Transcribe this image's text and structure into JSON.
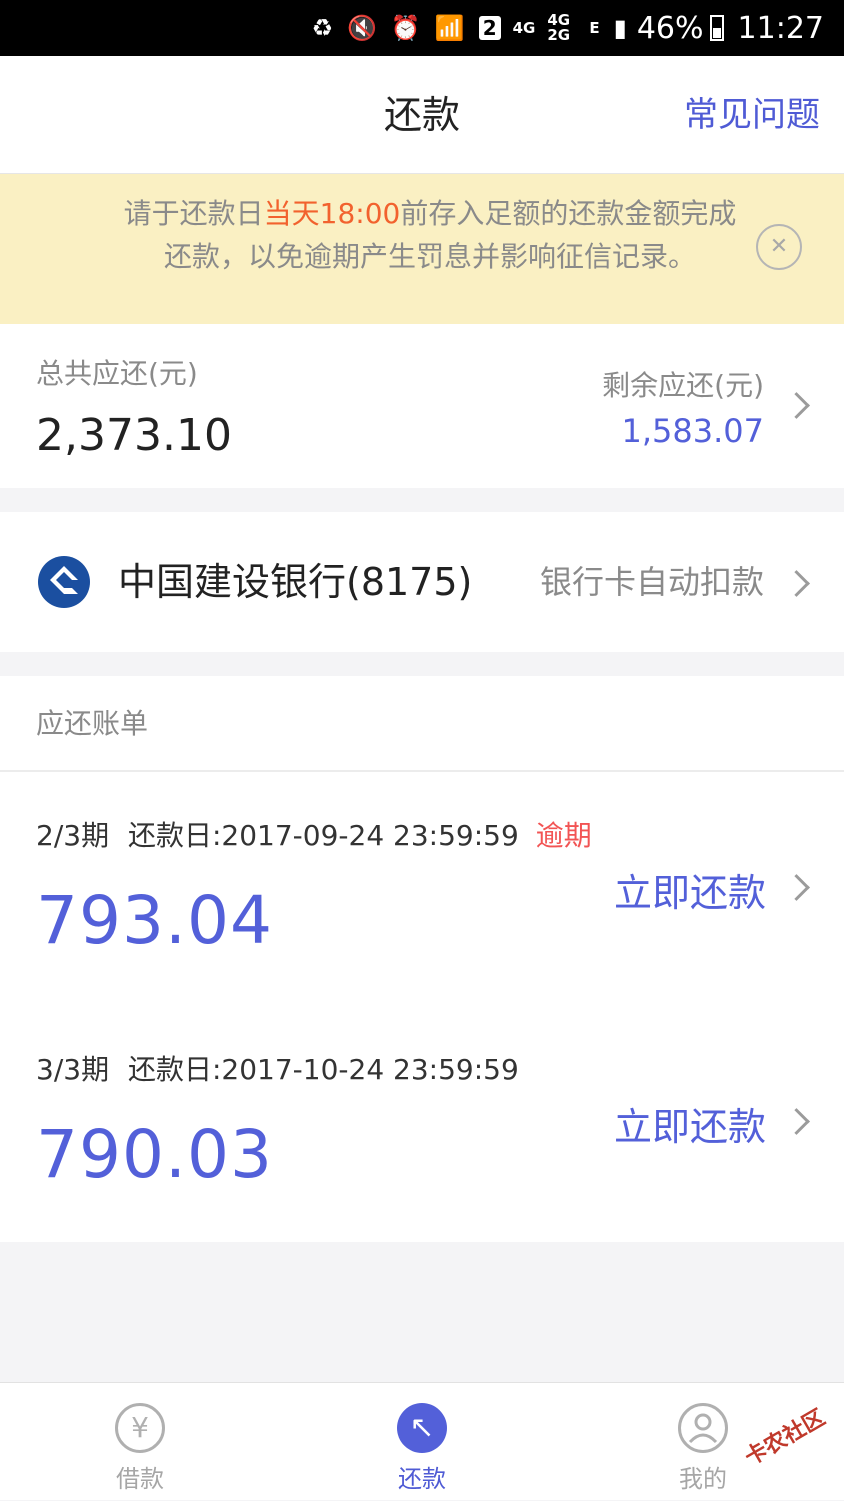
{
  "status_bar": {
    "sim": "2",
    "network_4g": "4G",
    "network_4g2g": "4G 2G",
    "network_e": "E",
    "battery": "46%",
    "time": "11:27"
  },
  "header": {
    "title": "还款",
    "faq_label": "常见问题"
  },
  "notice": {
    "text_before": "请于还款日",
    "text_highlight": "当天18:00",
    "text_after": "前存入足额的还款金额完成还款，以免逾期产生罚息并影响征信记录。",
    "highlight_color": "#f2622e"
  },
  "summary": {
    "total_label": "总共应还(元)",
    "total_value": "2,373.10",
    "remaining_label": "剩余应还(元)",
    "remaining_value": "1,583.07"
  },
  "bank": {
    "name": "中国建设银行(8175)",
    "mode": "银行卡自动扣款"
  },
  "bills": {
    "title": "应还账单",
    "items": [
      {
        "period": "2/3期",
        "due_label": "还款日:2017-09-24 23:59:59",
        "status": "逾期",
        "amount": "793.04",
        "action": "立即还款"
      },
      {
        "period": "3/3期",
        "due_label": "还款日:2017-10-24 23:59:59",
        "status": "",
        "amount": "790.03",
        "action": "立即还款"
      }
    ]
  },
  "tabbar": {
    "items": [
      {
        "label": "借款",
        "icon": "yuan-icon",
        "active": false
      },
      {
        "label": "还款",
        "icon": "repay-icon",
        "active": true
      },
      {
        "label": "我的",
        "icon": "user-icon",
        "active": false
      }
    ]
  },
  "watermark": "卡农社区",
  "colors": {
    "accent": "#5360d9",
    "overdue": "#f25454",
    "notice_bg": "#faf0c3",
    "bank_blue": "#1b4fa0"
  }
}
